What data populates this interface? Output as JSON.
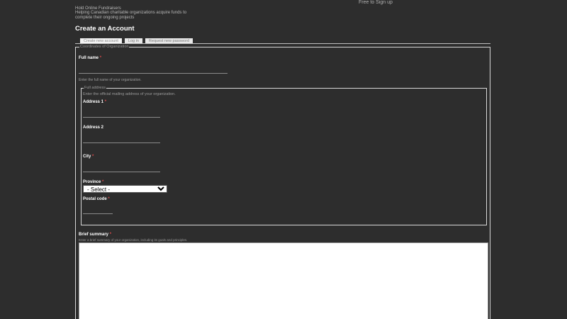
{
  "header": {
    "signup_link": "Free to Sign up",
    "site_name": "Hold Online Fundraisers",
    "slogan": "Helping Canadian charitable organizations acquire funds to complete their ongoing projects"
  },
  "page_title": "Create an Account",
  "tabs": [
    {
      "label": "Create new account"
    },
    {
      "label": "Log in"
    },
    {
      "label": "Request new password"
    }
  ],
  "form": {
    "org_legend": "Coordinates of Organization",
    "full_name": {
      "label": "Full name",
      "required": "*",
      "description": "Enter the full name of your organization."
    },
    "address_legend": "Full address",
    "address_description": "Enter the official mailing address of your organization.",
    "address1": {
      "label": "Address 1",
      "required": "*"
    },
    "address2": {
      "label": "Address 2"
    },
    "city": {
      "label": "City",
      "required": "*"
    },
    "province": {
      "label": "Province",
      "required": "*",
      "selected": "- Select -"
    },
    "postal_code": {
      "label": "Postal code",
      "required": "*"
    },
    "summary": {
      "label": "Brief summary",
      "required": "*",
      "description": "Enter a brief summary of your organization, including its goals and principles."
    }
  },
  "colors": {
    "background": "#2d2d2d",
    "required": "#d94a4a",
    "heading": "#ffffff"
  }
}
